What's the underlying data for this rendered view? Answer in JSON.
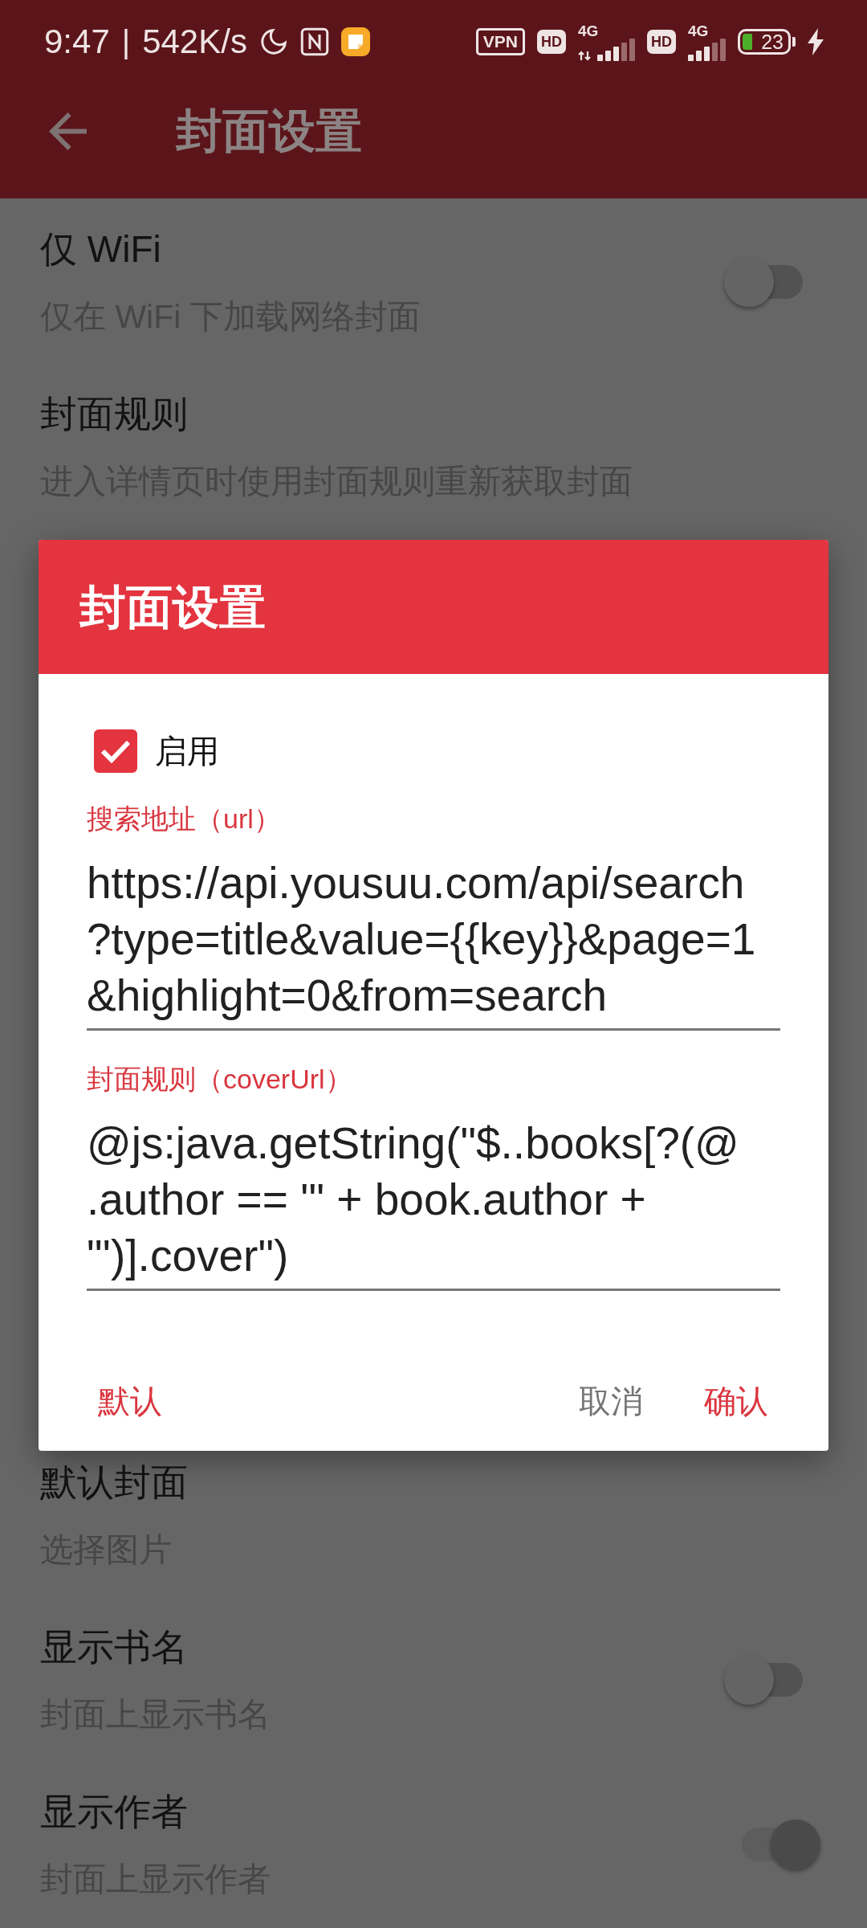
{
  "status_bar": {
    "time": "9:47",
    "separator": "|",
    "speed": "542K/s",
    "vpn": "VPN",
    "sims": [
      {
        "hd": "HD",
        "network": "4G",
        "activity": true
      },
      {
        "hd": "HD",
        "network": "4G",
        "activity": false
      }
    ],
    "battery": "23"
  },
  "app_bar": {
    "title": "封面设置"
  },
  "settings_top": [
    {
      "kind": "toggle",
      "title": "仅 WiFi",
      "summary": "仅在 WiFi 下加载网络封面",
      "on": false
    },
    {
      "kind": "plain",
      "title": "封面规则",
      "summary": "进入详情页时使用封面规则重新获取封面"
    }
  ],
  "dialog": {
    "title": "封面设置",
    "enable": {
      "label": "启用",
      "checked": true
    },
    "fields": [
      {
        "label": "搜索地址（url）",
        "value": "https://api.yousuu.com/api/search?type=title&value={{key}}&page=1&highlight=0&from=search"
      },
      {
        "label": "封面规则（coverUrl）",
        "value": "@js:java.getString(\"$..books[?(@.author == '\" + book.author + \"')].cover\")"
      }
    ],
    "buttons": [
      {
        "kind": "neutral",
        "label": "默认"
      },
      {
        "kind": "negative",
        "label": "取消"
      },
      {
        "kind": "positive",
        "label": "确认"
      }
    ]
  },
  "settings_bottom": [
    {
      "kind": "plain",
      "title": "默认封面",
      "summary": "选择图片"
    },
    {
      "kind": "toggle",
      "title": "显示书名",
      "summary": "封面上显示书名",
      "on": false
    },
    {
      "kind": "toggle",
      "title": "显示作者",
      "summary": "封面上显示作者",
      "on": true
    }
  ]
}
